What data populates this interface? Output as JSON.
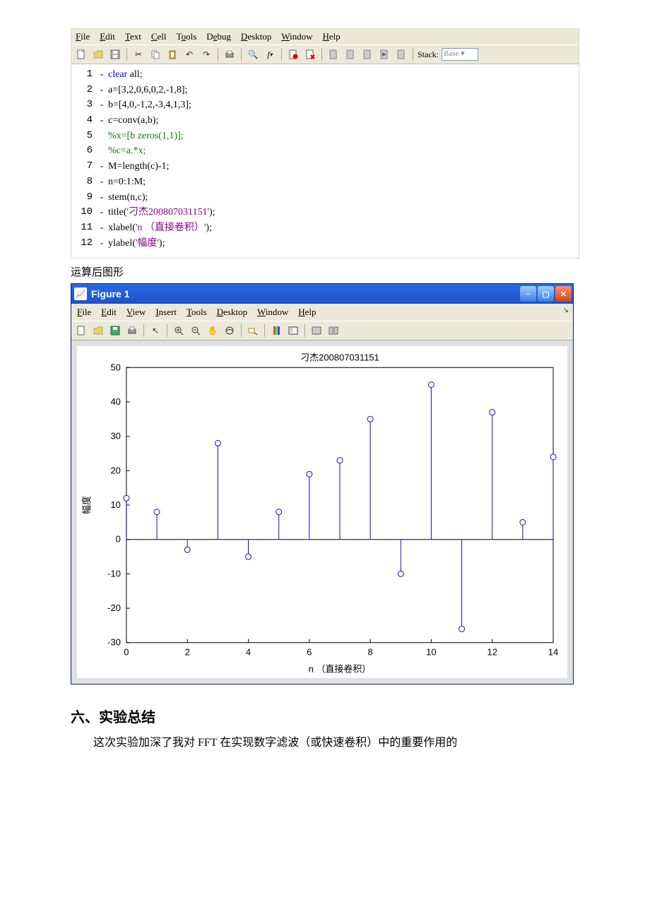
{
  "editor": {
    "menus": [
      "File",
      "Edit",
      "Text",
      "Cell",
      "Tools",
      "Debug",
      "Desktop",
      "Window",
      "Help"
    ],
    "menu_underline": [
      0,
      0,
      0,
      0,
      1,
      1,
      0,
      0,
      0
    ],
    "stack_label": "Stack:",
    "stack_value": "Base",
    "code": [
      {
        "n": "1",
        "d": "-",
        "tokens": [
          {
            "c": "c-kw",
            "t": "clear "
          },
          {
            "t": "all;"
          }
        ]
      },
      {
        "n": "2",
        "d": "-",
        "tokens": [
          {
            "t": "a=[3,2,0,6,0,2,-1,8];"
          }
        ]
      },
      {
        "n": "3",
        "d": "-",
        "tokens": [
          {
            "t": "b=[4,0,-1,2,-3,4,1,3];"
          }
        ]
      },
      {
        "n": "4",
        "d": "-",
        "tokens": [
          {
            "t": "c=conv(a,b);"
          }
        ]
      },
      {
        "n": "5",
        "d": "",
        "tokens": [
          {
            "c": "c-com",
            "t": "%x=[b zeros(1,1)];"
          }
        ]
      },
      {
        "n": "6",
        "d": "",
        "tokens": [
          {
            "c": "c-com",
            "t": "%c=a.*x;"
          }
        ]
      },
      {
        "n": "7",
        "d": "-",
        "tokens": [
          {
            "t": "M=length(c)-1;"
          }
        ]
      },
      {
        "n": "8",
        "d": "-",
        "tokens": [
          {
            "t": "n=0:1:M;"
          }
        ]
      },
      {
        "n": "9",
        "d": "-",
        "tokens": [
          {
            "t": "stem(n,c);"
          }
        ]
      },
      {
        "n": "10",
        "d": "-",
        "tokens": [
          {
            "t": "title("
          },
          {
            "c": "c-str",
            "t": "'刁杰200807031151'"
          },
          {
            "t": ");"
          }
        ]
      },
      {
        "n": "11",
        "d": "-",
        "tokens": [
          {
            "t": "xlabel("
          },
          {
            "c": "c-str",
            "t": "'n （直接卷积）'"
          },
          {
            "t": ");"
          }
        ]
      },
      {
        "n": "12",
        "d": "-",
        "tokens": [
          {
            "t": "ylabel("
          },
          {
            "c": "c-str",
            "t": "'幅度'"
          },
          {
            "t": ");"
          }
        ]
      }
    ]
  },
  "caption": "运算后图形",
  "figure": {
    "title": "Figure 1",
    "menus": [
      "File",
      "Edit",
      "View",
      "Insert",
      "Tools",
      "Desktop",
      "Window",
      "Help"
    ]
  },
  "chart_data": {
    "type": "stem",
    "title": "刁杰200807031151",
    "xlabel": "n （直接卷积）",
    "ylabel": "幅度",
    "xticks": [
      0,
      2,
      4,
      6,
      8,
      10,
      12,
      14
    ],
    "yticks": [
      -30,
      -20,
      -10,
      0,
      10,
      20,
      30,
      40,
      50
    ],
    "xlim": [
      0,
      14
    ],
    "ylim": [
      -30,
      50
    ],
    "x": [
      0,
      1,
      2,
      3,
      4,
      5,
      6,
      7,
      8,
      9,
      10,
      11,
      12,
      13,
      14
    ],
    "values": [
      12,
      8,
      -3,
      28,
      -5,
      8,
      19,
      23,
      35,
      -10,
      45,
      -26,
      37,
      5,
      24
    ]
  },
  "doc": {
    "heading": "六、实验总结",
    "para": "这次实验加深了我对 FFT 在实现数字滤波（或快速卷积）中的重要作用的"
  }
}
